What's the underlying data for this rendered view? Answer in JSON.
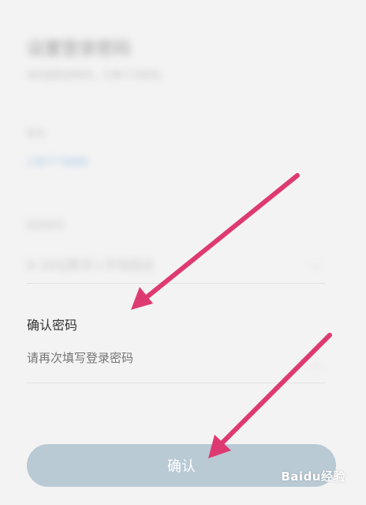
{
  "header": {
    "title": "设置登录密码",
    "subtitle": "请设置登录密码，方便下次登录。"
  },
  "account": {
    "label": "账号",
    "value": "138****8888"
  },
  "password": {
    "label": "登录密码",
    "placeholder": "8-16位数字+字母组合"
  },
  "confirm_password": {
    "label": "确认密码",
    "placeholder": "请再次填写登录密码"
  },
  "actions": {
    "confirm_label": "确认"
  },
  "watermark": {
    "text": "Baidu经验"
  },
  "colors": {
    "arrow": "#de3a72",
    "button": "#b9cad5",
    "background": "#f3f3f3"
  },
  "icons": {
    "eye": "eye-icon",
    "arrow": "arrow-annotation-icon"
  }
}
